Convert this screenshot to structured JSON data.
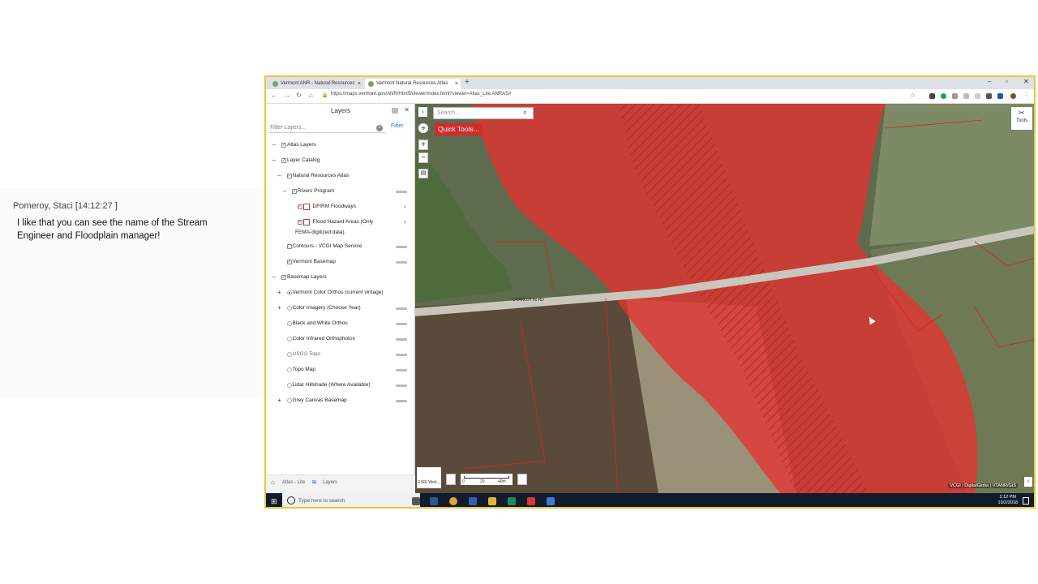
{
  "chat": {
    "sender": "Pomeroy, Staci [14:12:27 ]",
    "message": "I like that you can see the name of the Stream Engineer and Floodplain manager!"
  },
  "browser": {
    "tabs": [
      {
        "label": "Vermont ANR - Natural Resources"
      },
      {
        "label": "Vermont Natural Resources Atlas"
      }
    ],
    "url": "https://maps.vermont.gov/ANR/Html5Viewer/index.html?viewer=Atlas_Lite.ANRAS#"
  },
  "panel": {
    "title": "Layers",
    "filter_placeholder": "Filter Layers...",
    "filter_button": "Filter",
    "layers": [
      {
        "label": "Atlas Layers",
        "toggle": "–",
        "control": "checkbox",
        "checked": true
      },
      {
        "label": "Layer Catalog",
        "toggle": "–",
        "control": "checkbox",
        "checked": true
      },
      {
        "label": "Natural Resources Atlas",
        "toggle": "–",
        "control": "checkbox",
        "checked": true
      },
      {
        "label": "Rivers Program",
        "toggle": "–",
        "control": "checkbox",
        "checked": true
      },
      {
        "label": "DFIRM Floodways",
        "toggle": "",
        "control": "checkbox",
        "checked": true
      },
      {
        "label": "Flood Hazard Areas (Only",
        "toggle": "",
        "control": "checkbox",
        "checked": true
      },
      {
        "label": "FEMA-digitized data)",
        "toggle": "",
        "control": "none",
        "checked": false
      },
      {
        "label": "Contours - VCGI Map Service",
        "toggle": "",
        "control": "checkbox",
        "checked": false
      },
      {
        "label": "Vermont Basemap",
        "toggle": "",
        "control": "checkbox",
        "checked": true
      },
      {
        "label": "Basemap Layers",
        "toggle": "–",
        "control": "checkbox",
        "checked": true
      },
      {
        "label": "Vermont Color Orthos (current vintage)",
        "toggle": "+",
        "control": "radio",
        "checked": true
      },
      {
        "label": "Color Imagery (Choose Year)",
        "toggle": "+",
        "control": "radio",
        "checked": false
      },
      {
        "label": "Black and White Orthos",
        "toggle": "",
        "control": "radio",
        "checked": false
      },
      {
        "label": "Color Infrared Orthophotos",
        "toggle": "",
        "control": "radio",
        "checked": false
      },
      {
        "label": "USGS Topo",
        "toggle": "",
        "control": "radio",
        "checked": false
      },
      {
        "label": "Topo Map",
        "toggle": "",
        "control": "radio",
        "checked": false
      },
      {
        "label": "Lidar Hillshade (Where Available)",
        "toggle": "",
        "control": "radio",
        "checked": false
      },
      {
        "label": "Grey Canvas Basemap",
        "toggle": "+",
        "control": "radio",
        "checked": false
      }
    ],
    "footer": {
      "home": "Atlas - Lite",
      "layers": "Layers"
    }
  },
  "map": {
    "search_placeholder": "Search...",
    "quick_tools": "Quick Tools...",
    "tools_label": "Tools",
    "basemap_label": "ESRI Worl...",
    "scale_labels": [
      "0",
      "20",
      "40m"
    ],
    "attribution": "VCGI | DigitalGlobe | VTANR/GIS",
    "road_label": "CHARLOTTE RD"
  },
  "taskbar": {
    "search_placeholder": "Type here to search",
    "time": "2:12 PM",
    "date": "10/2/2018"
  },
  "colors": {
    "flood_red": "#e53232",
    "accent_blue": "#2a6ebd",
    "border_gold": "#e6c93a"
  }
}
